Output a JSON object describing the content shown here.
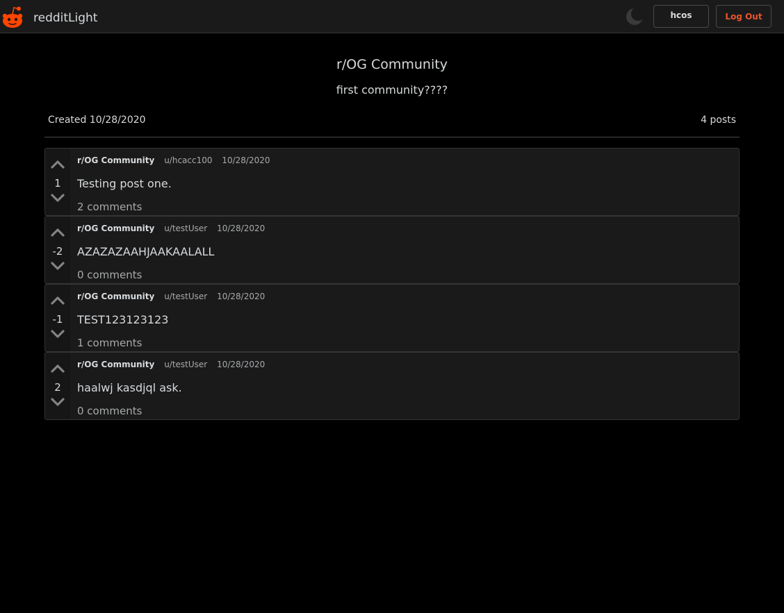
{
  "app": {
    "brand": "redditLight"
  },
  "header": {
    "username": "hcos",
    "logout_label": "Log Out"
  },
  "community": {
    "title": "r/OG Community",
    "description": "first community????",
    "created": "Created 10/28/2020",
    "post_count": "4 posts"
  },
  "posts": [
    {
      "community": "r/OG Community",
      "user": "u/hcacc100",
      "date": "10/28/2020",
      "score": "1",
      "title": "Testing post one.",
      "comments": "2 comments"
    },
    {
      "community": "r/OG Community",
      "user": "u/testUser",
      "date": "10/28/2020",
      "score": "-2",
      "title": "AZAZAZAAHJAAKAALALL",
      "comments": "0 comments"
    },
    {
      "community": "r/OG Community",
      "user": "u/testUser",
      "date": "10/28/2020",
      "score": "-1",
      "title": "TEST123123123",
      "comments": "1 comments"
    },
    {
      "community": "r/OG Community",
      "user": "u/testUser",
      "date": "10/28/2020",
      "score": "2",
      "title": "haalwj kasdjql ask.",
      "comments": "0 comments"
    }
  ],
  "colors": {
    "accent": "#ff4500",
    "logout": "#e8552b",
    "background": "#000000",
    "card": "#1a1a1b"
  },
  "icons": {
    "logo": "reddit-logo-icon",
    "theme_toggle": "moon-icon",
    "upvote": "chevron-up-icon",
    "downvote": "chevron-down-icon"
  }
}
